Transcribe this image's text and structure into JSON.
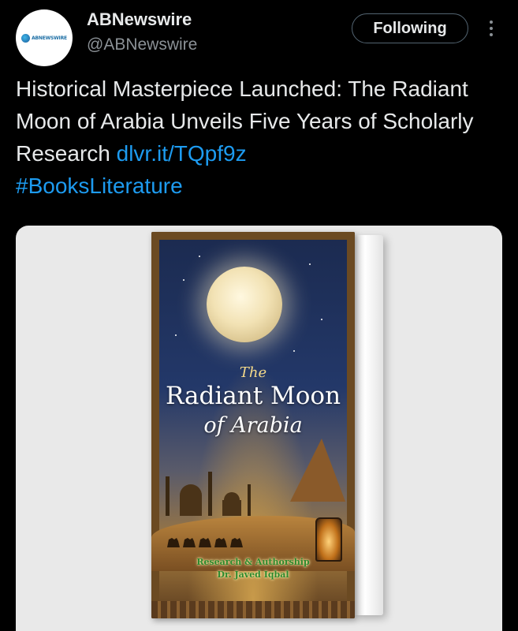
{
  "author": {
    "display_name": "ABNewswire",
    "handle": "@ABNewswire",
    "avatar_text": "ABNEWSWIRE"
  },
  "actions": {
    "follow_label": "Following",
    "more_icon": "more-vertical-icon"
  },
  "tweet": {
    "text": "Historical Masterpiece Launched: The Radiant Moon of Arabia Unveils Five Years of Scholarly Research",
    "link": "dlvr.it/TQpf9z",
    "hashtag": "#BooksLiterature"
  },
  "media": {
    "cover_title_the": "The",
    "cover_title_main": "Radiant Moon",
    "cover_title_sub": "of Arabia",
    "credit_line_1": "Research & Authorship",
    "credit_line_2": "Dr. Javed Iqbal"
  },
  "colors": {
    "background": "#000000",
    "text": "#e7e9ea",
    "secondary_text": "#8b9196",
    "link": "#1d9bf0",
    "media_background": "#e9e9e9"
  }
}
